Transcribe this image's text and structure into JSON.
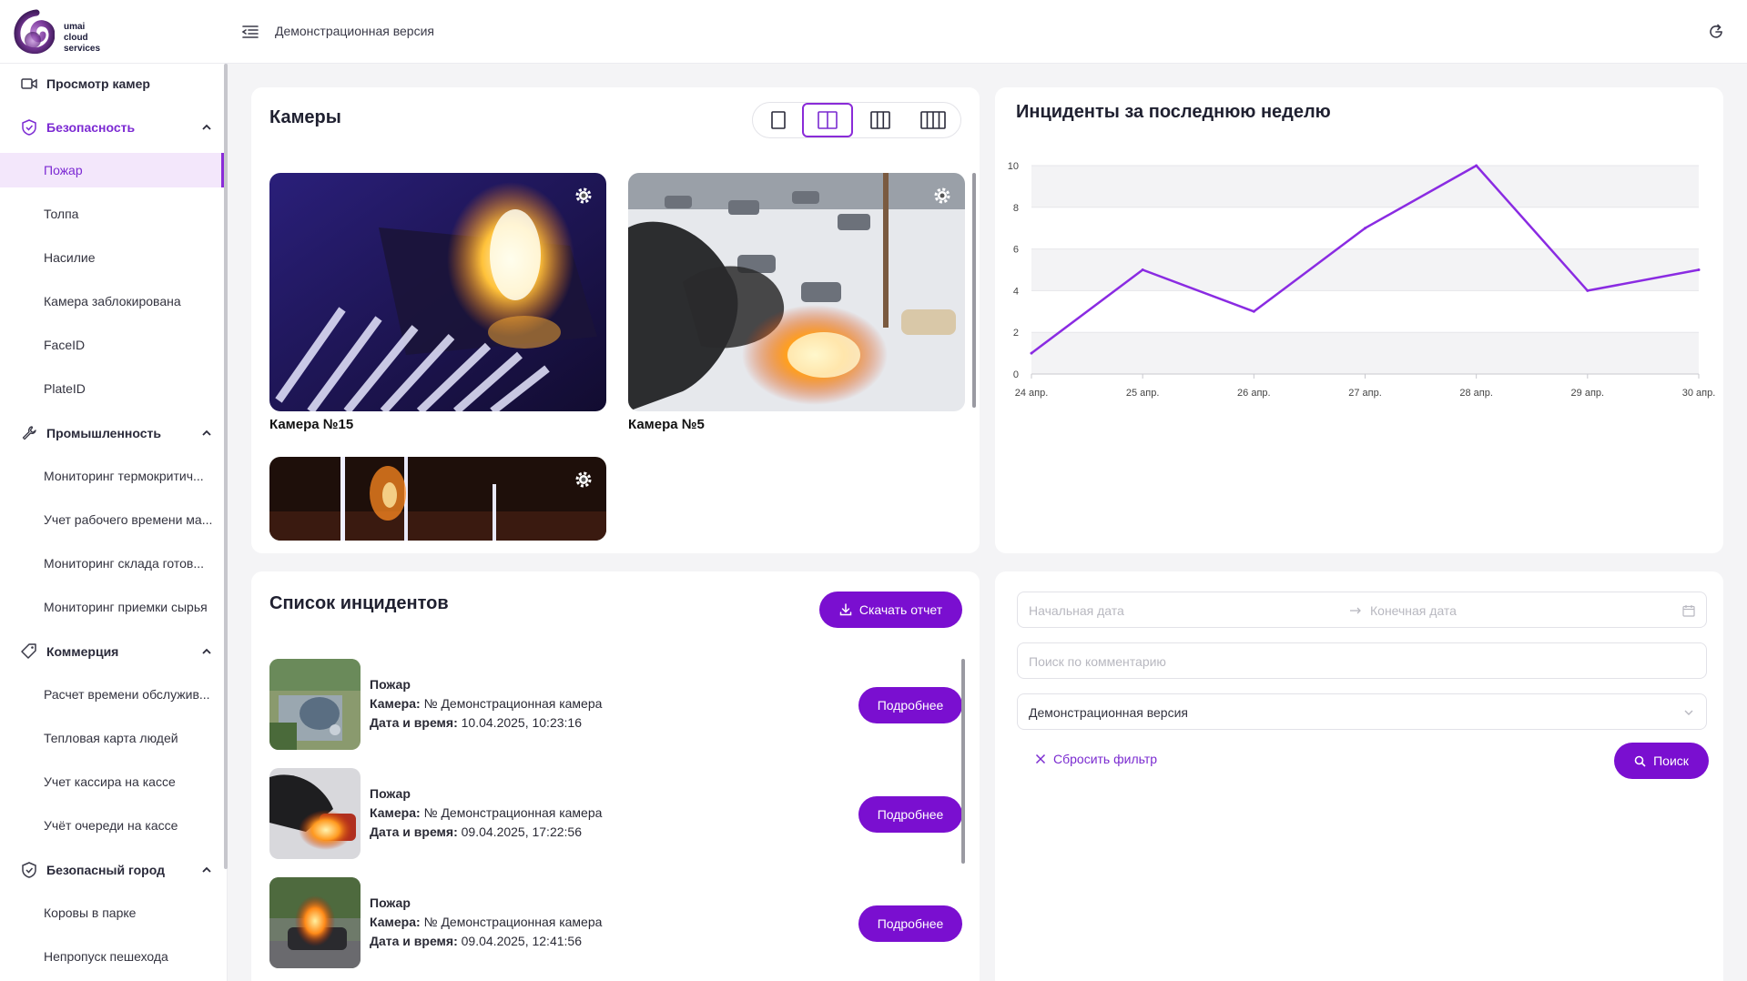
{
  "app": {
    "logo_lines": [
      "umai",
      "cloud",
      "services"
    ],
    "header_title": "Демонстрационная версия"
  },
  "sidebar": {
    "groups": [
      {
        "label": "Просмотр камер",
        "icon": "video-camera-icon",
        "expandable": false
      },
      {
        "label": "Безопасность",
        "icon": "shield-icon",
        "expandable": true,
        "active": true,
        "items": [
          "Пожар",
          "Толпа",
          "Насилие",
          "Камера заблокирована",
          "FaceID",
          "PlateID"
        ]
      },
      {
        "label": "Промышленность",
        "icon": "wrench-icon",
        "expandable": true,
        "items": [
          "Мониторинг термокритич...",
          "Учет рабочего времени ма...",
          "Мониторинг склада готов...",
          "Мониторинг приемки сырья"
        ]
      },
      {
        "label": "Коммерция",
        "icon": "tag-icon",
        "expandable": true,
        "items": [
          "Расчет времени обслужив...",
          "Тепловая карта людей",
          "Учет кассира на кассе",
          "Учёт очереди на кассе"
        ]
      },
      {
        "label": "Безопасный город",
        "icon": "shield-icon",
        "expandable": true,
        "items": [
          "Коровы в парке",
          "Непропуск пешехода"
        ]
      }
    ],
    "selected_item": "Пожар"
  },
  "cameras": {
    "title": "Камеры",
    "layout_options": [
      "single-column-icon",
      "two-columns-icon",
      "three-columns-icon",
      "four-columns-icon"
    ],
    "active_layout": "two-columns-icon",
    "tiles": [
      {
        "label": "Камера №15"
      },
      {
        "label": "Камера №5"
      },
      {
        "label": ""
      }
    ]
  },
  "chart_data": {
    "type": "line",
    "title": "Инциденты за последнюю неделю",
    "categories": [
      "24 апр.",
      "25 апр.",
      "26 апр.",
      "27 апр.",
      "28 апр.",
      "29 апр.",
      "30 апр."
    ],
    "values": [
      1,
      5,
      3,
      7,
      10,
      4,
      5
    ],
    "ylim": [
      0,
      10
    ],
    "yticks": [
      "0",
      "2",
      "4",
      "6",
      "8",
      "10"
    ],
    "line_color": "#8a2be2",
    "band_color": "#f3f3f5",
    "grid": true
  },
  "incidents": {
    "title": "Список инцидентов",
    "download_label": "Скачать отчет",
    "camera_prefix": "Камера:",
    "datetime_prefix": "Дата и время:",
    "details_label": "Подробнее",
    "items": [
      {
        "type": "Пожар",
        "camera": "№ Демонстрационная камера",
        "datetime": "10.04.2025, 10:23:16"
      },
      {
        "type": "Пожар",
        "camera": "№ Демонстрационная камера",
        "datetime": "09.04.2025, 17:22:56"
      },
      {
        "type": "Пожар",
        "camera": "№ Демонстрационная камера",
        "datetime": "09.04.2025, 12:41:56"
      }
    ]
  },
  "filters": {
    "start_date_placeholder": "Начальная дата",
    "end_date_placeholder": "Конечная дата",
    "comment_placeholder": "Поиск по комментарию",
    "version_value": "Демонстрационная версия",
    "reset_label": "Сбросить фильтр",
    "search_label": "Поиск"
  },
  "colors": {
    "accent": "#7a0fd0",
    "accent_light": "#f3e7fb"
  }
}
